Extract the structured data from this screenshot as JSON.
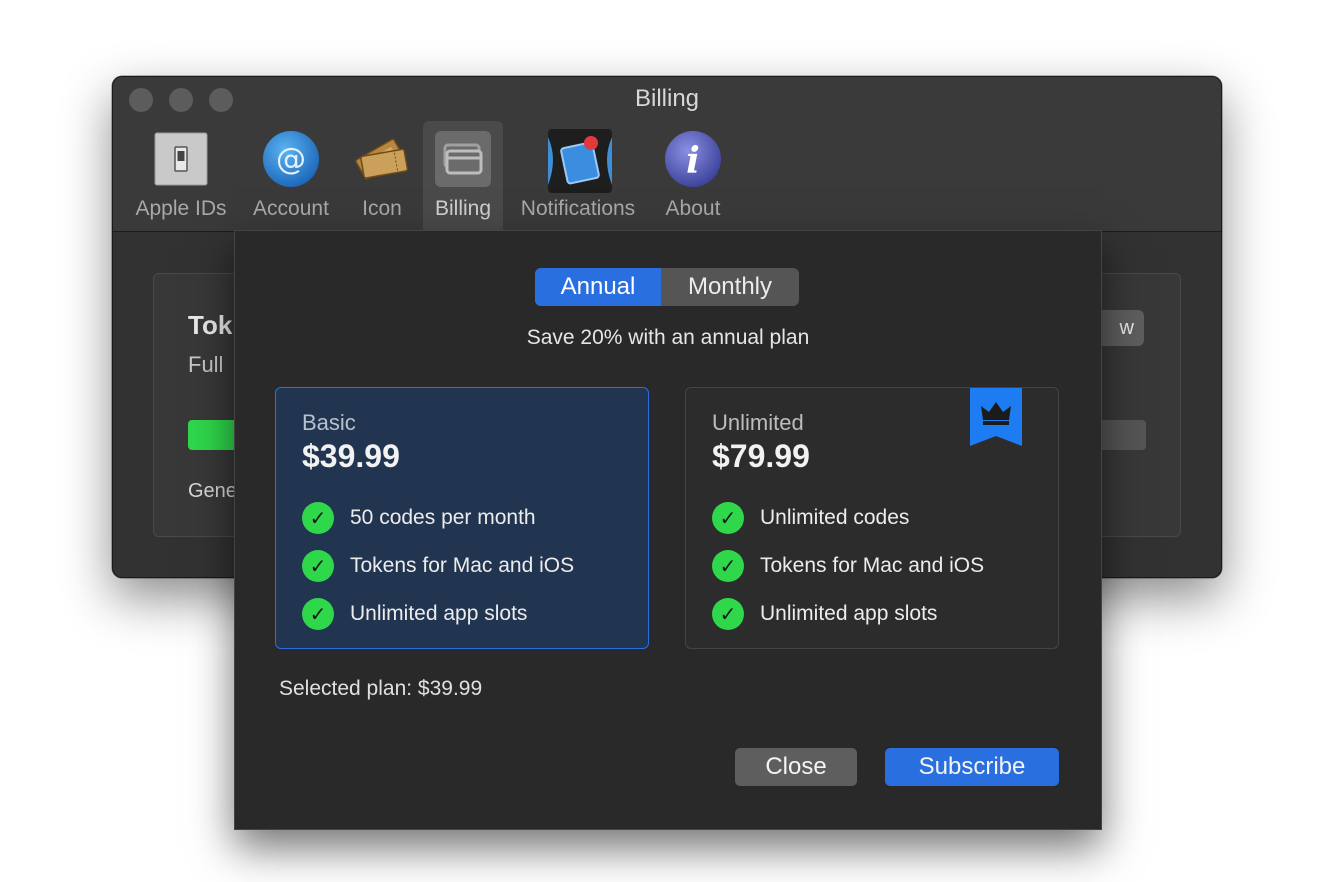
{
  "window": {
    "title": "Billing"
  },
  "toolbar": {
    "items": [
      {
        "label": "Apple IDs",
        "icon": "apple-id-switch-icon"
      },
      {
        "label": "Account",
        "icon": "at-sign-icon"
      },
      {
        "label": "Icon",
        "icon": "tickets-icon"
      },
      {
        "label": "Billing",
        "icon": "cards-icon",
        "selected": true
      },
      {
        "label": "Notifications",
        "icon": "notification-badge-icon"
      },
      {
        "label": "About",
        "icon": "info-icon"
      }
    ]
  },
  "background": {
    "title_partial": "Tok",
    "subtitle_partial": "Full",
    "footer_partial": "Gene",
    "button_partial": "w"
  },
  "sheet": {
    "segment": {
      "options": [
        "Annual",
        "Monthly"
      ],
      "selected": "Annual"
    },
    "save_note": "Save 20% with an annual plan",
    "plans": [
      {
        "name": "Basic",
        "price": "$39.99",
        "features": [
          "50 codes per month",
          "Tokens for Mac and iOS",
          "Unlimited app slots"
        ],
        "selected": true
      },
      {
        "name": "Unlimited",
        "price": "$79.99",
        "features": [
          "Unlimited codes",
          "Tokens for Mac and iOS",
          "Unlimited app slots"
        ],
        "badge_icon": "crown-icon"
      }
    ],
    "selected_plan_text": "Selected plan: $39.99",
    "close_label": "Close",
    "subscribe_label": "Subscribe"
  },
  "colors": {
    "accent": "#2a6fe0",
    "check": "#2fd74b",
    "ribbon": "#1e7cf2"
  }
}
